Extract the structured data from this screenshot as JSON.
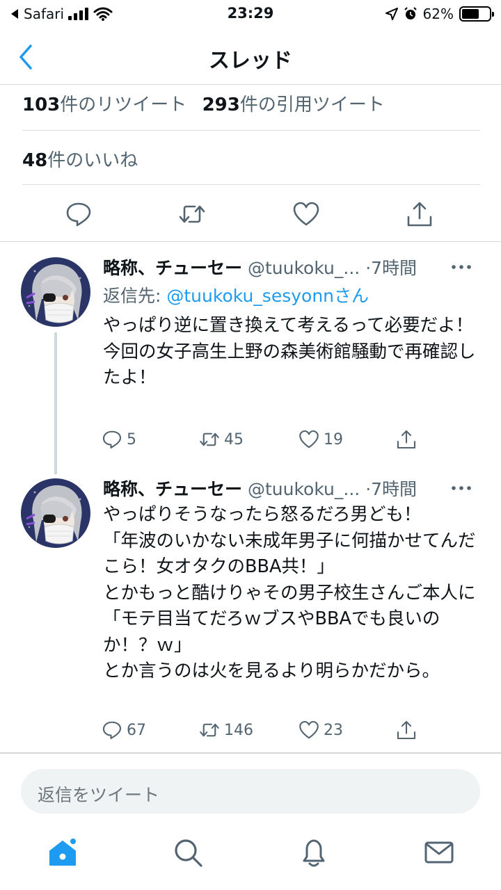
{
  "status_bar": {
    "carrier": "Safari",
    "time": "23:29",
    "battery": "62%",
    "battery_level": 0.62
  },
  "nav": {
    "title": "スレッド"
  },
  "stats": {
    "retweet_count": "103",
    "retweet_label": "件のリツイート",
    "quote_count": "293",
    "quote_label": "件の引用ツイート",
    "like_count": "48",
    "like_label": "件のいいね"
  },
  "tweets": [
    {
      "name": "略称、チューセー",
      "handle": "@tuukoku_...",
      "dot": "·",
      "time": "7時間",
      "reply_prefix": "返信先: ",
      "reply_handle": "@tuukoku_sesyonn",
      "reply_suffix": "さん",
      "text": "やっぱり逆に置き換えて考えるって必要だよ！\n今回の女子高生上野の森美術館騒動で再確認したよ！",
      "replies": "5",
      "retweets": "45",
      "likes": "19"
    },
    {
      "name": "略称、チューセー",
      "handle": "@tuukoku_...",
      "dot": "·",
      "time": "7時間",
      "text": "やっぱりそうなったら怒るだろ男ども！\n「年波のいかない未成年男子に何描かせてんだこら！女オタクのBBA共！」\nとかもっと酷けりゃその男子校生さんご本人に\n「モテ目当てだろｗブスやBBAでも良いのか！？ｗ」\nとか言うのは火を見るより明らかだから。",
      "replies": "67",
      "retweets": "146",
      "likes": "23"
    }
  ],
  "reply_box": {
    "placeholder": "返信をツイート"
  },
  "colors": {
    "accent": "#1d9bf0",
    "secondary_text": "#536471",
    "divider": "#d6d6d6"
  },
  "icons": [
    "back-chevron-icon",
    "reply-icon",
    "retweet-icon",
    "like-icon",
    "share-icon",
    "more-icon",
    "home-icon",
    "search-icon",
    "notifications-icon",
    "messages-icon"
  ]
}
